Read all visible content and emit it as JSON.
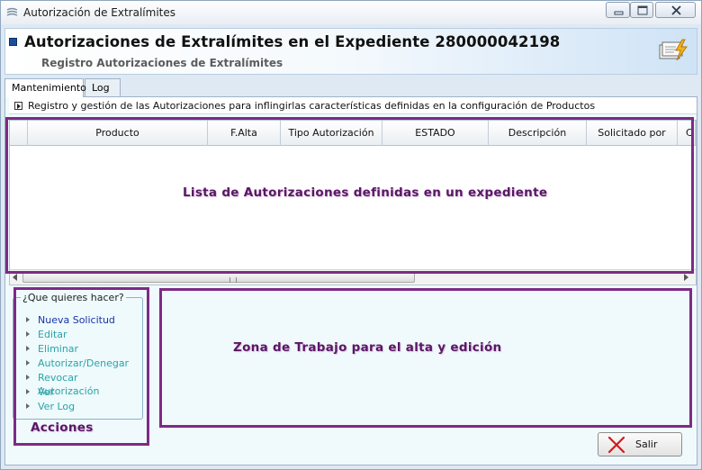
{
  "window": {
    "title": "Autorización de Extralímites",
    "min_icon": "minimize-icon",
    "max_icon": "maximize-icon",
    "close_icon": "close-icon"
  },
  "header": {
    "title": "Autorizaciones de Extralímites en el Expediente 280000042198",
    "subtitle": "Registro Autorizaciones de Extralímites",
    "icon": "lightning-card-icon"
  },
  "tabs": [
    {
      "label": "Mantenimiento",
      "active": true
    },
    {
      "label": "Log",
      "active": false
    }
  ],
  "description": "Registro y gestión de las Autorizaciones para inflingirlas características definidas en la configuración de Productos",
  "grid": {
    "columns": [
      "Producto",
      "F.Alta",
      "Tipo Autorización",
      "ESTADO",
      "Descripción",
      "Solicitado por",
      "C"
    ]
  },
  "annotations": {
    "list": "Lista de Autorizaciones definidas en un expediente",
    "work": "Zona de Trabajo para el alta y edición",
    "actions": "Acciones"
  },
  "actions": {
    "legend": "¿Que quieres hacer?",
    "items": [
      {
        "label": "Nueva Solicitud"
      },
      {
        "label": "Editar"
      },
      {
        "label": "Eliminar"
      },
      {
        "label": "Autorizar/Denegar"
      },
      {
        "label": "Revocar Autorización"
      },
      {
        "label": "Ver"
      },
      {
        "label": "Ver Log"
      }
    ]
  },
  "footer": {
    "exit_label": "Salir",
    "exit_icon": "red-x-icon"
  },
  "colors": {
    "callout": "#7d2a86",
    "link": "#2aa3a8",
    "link_first": "#1a33a8",
    "panel_bg": "#f0fafc"
  }
}
